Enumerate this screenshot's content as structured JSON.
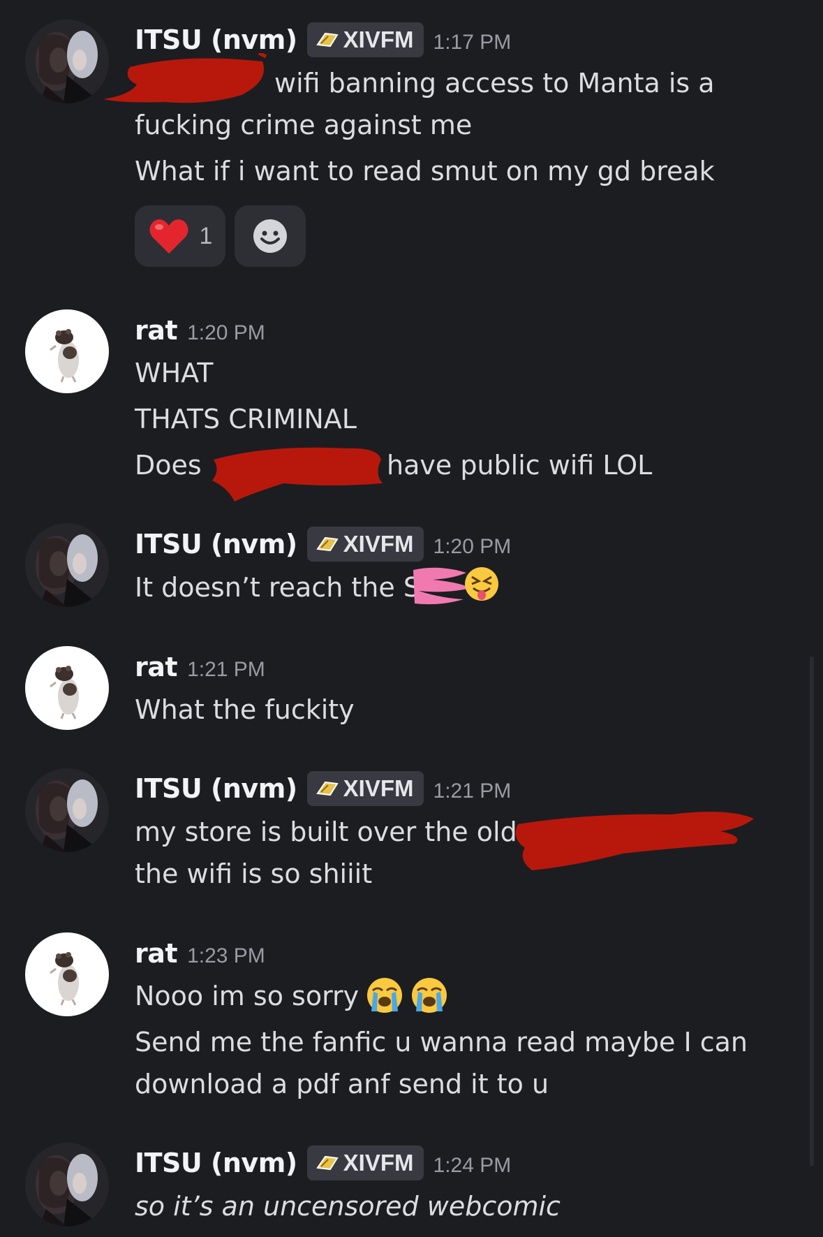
{
  "colors": {
    "background": "#1c1d21",
    "username": "#f2f3f5",
    "text": "#dcdde1",
    "timestamp": "#9b9ca3",
    "tag_bg": "#393a41",
    "reaction_bg": "#2e2f35",
    "redaction_red": "#b8180c",
    "redaction_pink": "#f07ab0"
  },
  "messages": [
    {
      "user": "ITSU (nvm)",
      "tag": "XIVFM",
      "time": "1:17 PM",
      "lines": [
        "wifi banning access to Manta is a",
        "fucking crime against me",
        "What if i want to read smut on my gd break"
      ],
      "reactions": [
        {
          "emoji": "heart-icon",
          "count": "1"
        },
        {
          "emoji": "add-reaction-icon"
        }
      ]
    },
    {
      "user": "rat",
      "time": "1:20 PM",
      "lines": [
        "WHAT",
        "THATS CRIMINAL",
        "Does",
        "have public wifi LOL"
      ]
    },
    {
      "user": "ITSU (nvm)",
      "tag": "XIVFM",
      "time": "1:20 PM",
      "lines": [
        "It doesn’t reach the S"
      ]
    },
    {
      "user": "rat",
      "time": "1:21 PM",
      "lines": [
        "What the fuckity"
      ]
    },
    {
      "user": "ITSU (nvm)",
      "tag": "XIVFM",
      "time": "1:21 PM",
      "lines": [
        "my store is built over the old",
        "the wifi is so shiiit"
      ]
    },
    {
      "user": "rat",
      "time": "1:23 PM",
      "lines": [
        "Nooo im so sorry",
        "Send me the fanfic u wanna read maybe I can",
        "download a pdf anf send it to u"
      ]
    },
    {
      "user": "ITSU (nvm)",
      "tag": "XIVFM",
      "time": "1:24 PM",
      "lines": [
        "so it’s an uncensored webcomic"
      ]
    }
  ]
}
